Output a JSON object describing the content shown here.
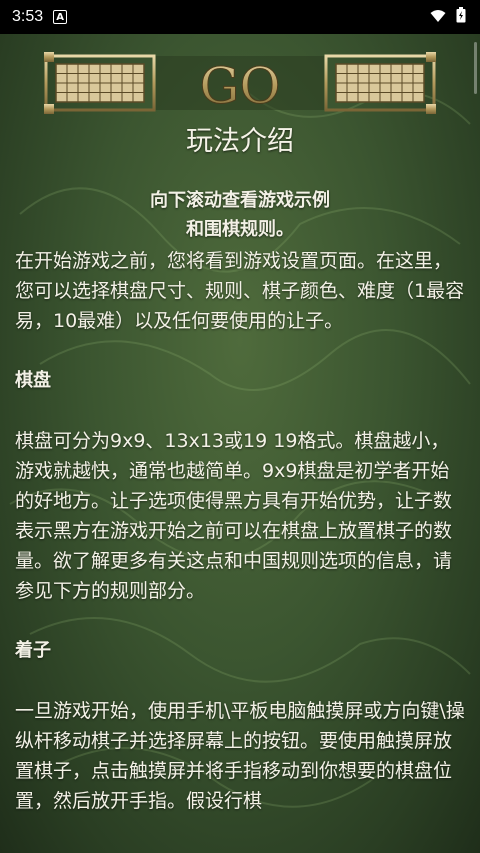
{
  "status": {
    "time": "3:53",
    "notification_letter": "A"
  },
  "banner": {
    "logo_text": "GO"
  },
  "page": {
    "title": "玩法介绍",
    "subtitle_line1": "向下滚动查看游戏示例",
    "subtitle_line2": "和围棋规则。"
  },
  "sections": {
    "intro": "在开始游戏之前，您将看到游戏设置页面。在这里，您可以选择棋盘尺寸、规则、棋子颜色、难度（1最容易，10最难）以及任何要使用的让子。",
    "board_heading": "棋盘",
    "board_text": "棋盘可分为9x9、13x13或19 19格式。棋盘越小，游戏就越快，通常也越简单。9x9棋盘是初学者开始的好地方。让子选项使得黑方具有开始优势，让子数表示黑方在游戏开始之前可以在棋盘上放置棋子的数量。欲了解更多有关这点和中国规则选项的信息，请参见下方的规则部分。",
    "move_heading": "着子",
    "move_text": "一旦游戏开始，使用手机\\平板电脑触摸屏或方向键\\操纵杆移动棋子并选择屏幕上的按钮。要使用触摸屏放置棋子，点击触摸屏并将手指移动到你想要的棋盘位置，然后放开手指。假设行棋"
  }
}
